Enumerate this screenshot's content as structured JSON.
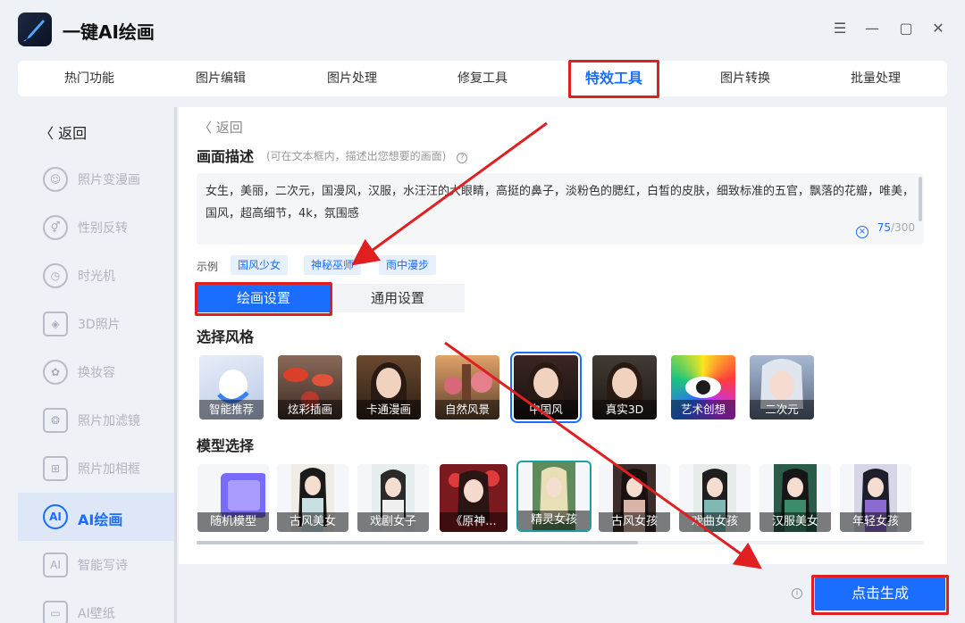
{
  "app": {
    "title": "一键AI绘画"
  },
  "window_controls": {
    "menu": "☰",
    "minimize": "—",
    "maximize": "▢",
    "close": "✕"
  },
  "topnav": {
    "items": [
      "热门功能",
      "图片编辑",
      "图片处理",
      "修复工具",
      "特效工具",
      "图片转换",
      "批量处理"
    ],
    "active": "特效工具"
  },
  "sidebar": {
    "back": "返回",
    "items": [
      {
        "label": "照片变漫画",
        "icon": "cartoon-face-icon"
      },
      {
        "label": "性别反转",
        "icon": "gender-icon"
      },
      {
        "label": "时光机",
        "icon": "clock-icon"
      },
      {
        "label": "3D照片",
        "icon": "layers-icon"
      },
      {
        "label": "换妆容",
        "icon": "makeup-icon"
      },
      {
        "label": "照片加滤镜",
        "icon": "filter-icon"
      },
      {
        "label": "照片加相框",
        "icon": "frame-icon"
      },
      {
        "label": "AI绘画",
        "icon": "ai-paint-icon"
      },
      {
        "label": "智能写诗",
        "icon": "ai-poem-icon"
      },
      {
        "label": "AI壁纸",
        "icon": "wallpaper-icon"
      }
    ],
    "active": "AI绘画"
  },
  "main": {
    "back": "返回",
    "description_title": "画面描述",
    "description_hint": "(可在文本框内，描述出您想要的画面)",
    "description_text": "女生，美丽，二次元，国漫风，汉服，水汪汪的大眼睛，高挺的鼻子，淡粉色的腮红，白皙的皮肤，细致标准的五官，飘落的花瓣，唯美，国风，超高细节，4k，氛围感",
    "char_count": "75",
    "char_max": "/300",
    "examples_label": "示例",
    "examples": [
      "国风少女",
      "神秘巫师",
      "雨中漫步"
    ],
    "tabs": [
      "绘画设置",
      "通用设置"
    ],
    "style_title": "选择风格",
    "styles": [
      "智能推荐",
      "炫彩插画",
      "卡通漫画",
      "自然风景",
      "中国风",
      "真实3D",
      "艺术创想",
      "二次元"
    ],
    "selected_style": "中国风",
    "model_title": "模型选择",
    "models": [
      "随机模型",
      "古风美女",
      "戏剧女子",
      "《原神...",
      "精灵女孩",
      "古风女孩",
      "戏曲女孩",
      "汉服美女",
      "年轻女孩"
    ],
    "selected_model": "精灵女孩"
  },
  "footer": {
    "generate_button": "点击生成"
  },
  "colors": {
    "accent": "#1a6dff",
    "annotation_red": "#e02020"
  }
}
